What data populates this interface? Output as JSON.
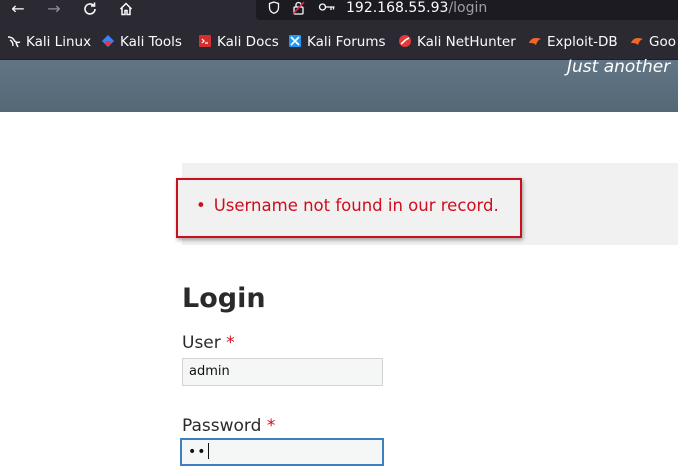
{
  "browser": {
    "url_host": "192.168.55.93",
    "url_path": "/login"
  },
  "bookmarks": [
    {
      "label": "Kali Linux",
      "icon": "kali-dragon-icon"
    },
    {
      "label": "Kali Tools",
      "icon": "kali-tools-icon"
    },
    {
      "label": "Kali Docs",
      "icon": "kali-docs-icon"
    },
    {
      "label": "Kali Forums",
      "icon": "kali-forums-icon"
    },
    {
      "label": "Kali NetHunter",
      "icon": "kali-nethunter-icon"
    },
    {
      "label": "Exploit-DB",
      "icon": "exploit-db-icon"
    },
    {
      "label": "Goo",
      "icon": "google-hacking-db-icon"
    }
  ],
  "site": {
    "tagline": "Just another"
  },
  "messages": {
    "error": "Username not found in our record."
  },
  "login": {
    "title": "Login",
    "user_label": "User",
    "user_value": "admin",
    "password_label": "Password",
    "password_value": "••",
    "required_marker": "*"
  },
  "colors": {
    "error": "#d00d1e",
    "header": "#5b6e7d",
    "focus": "#3d7fbf"
  }
}
